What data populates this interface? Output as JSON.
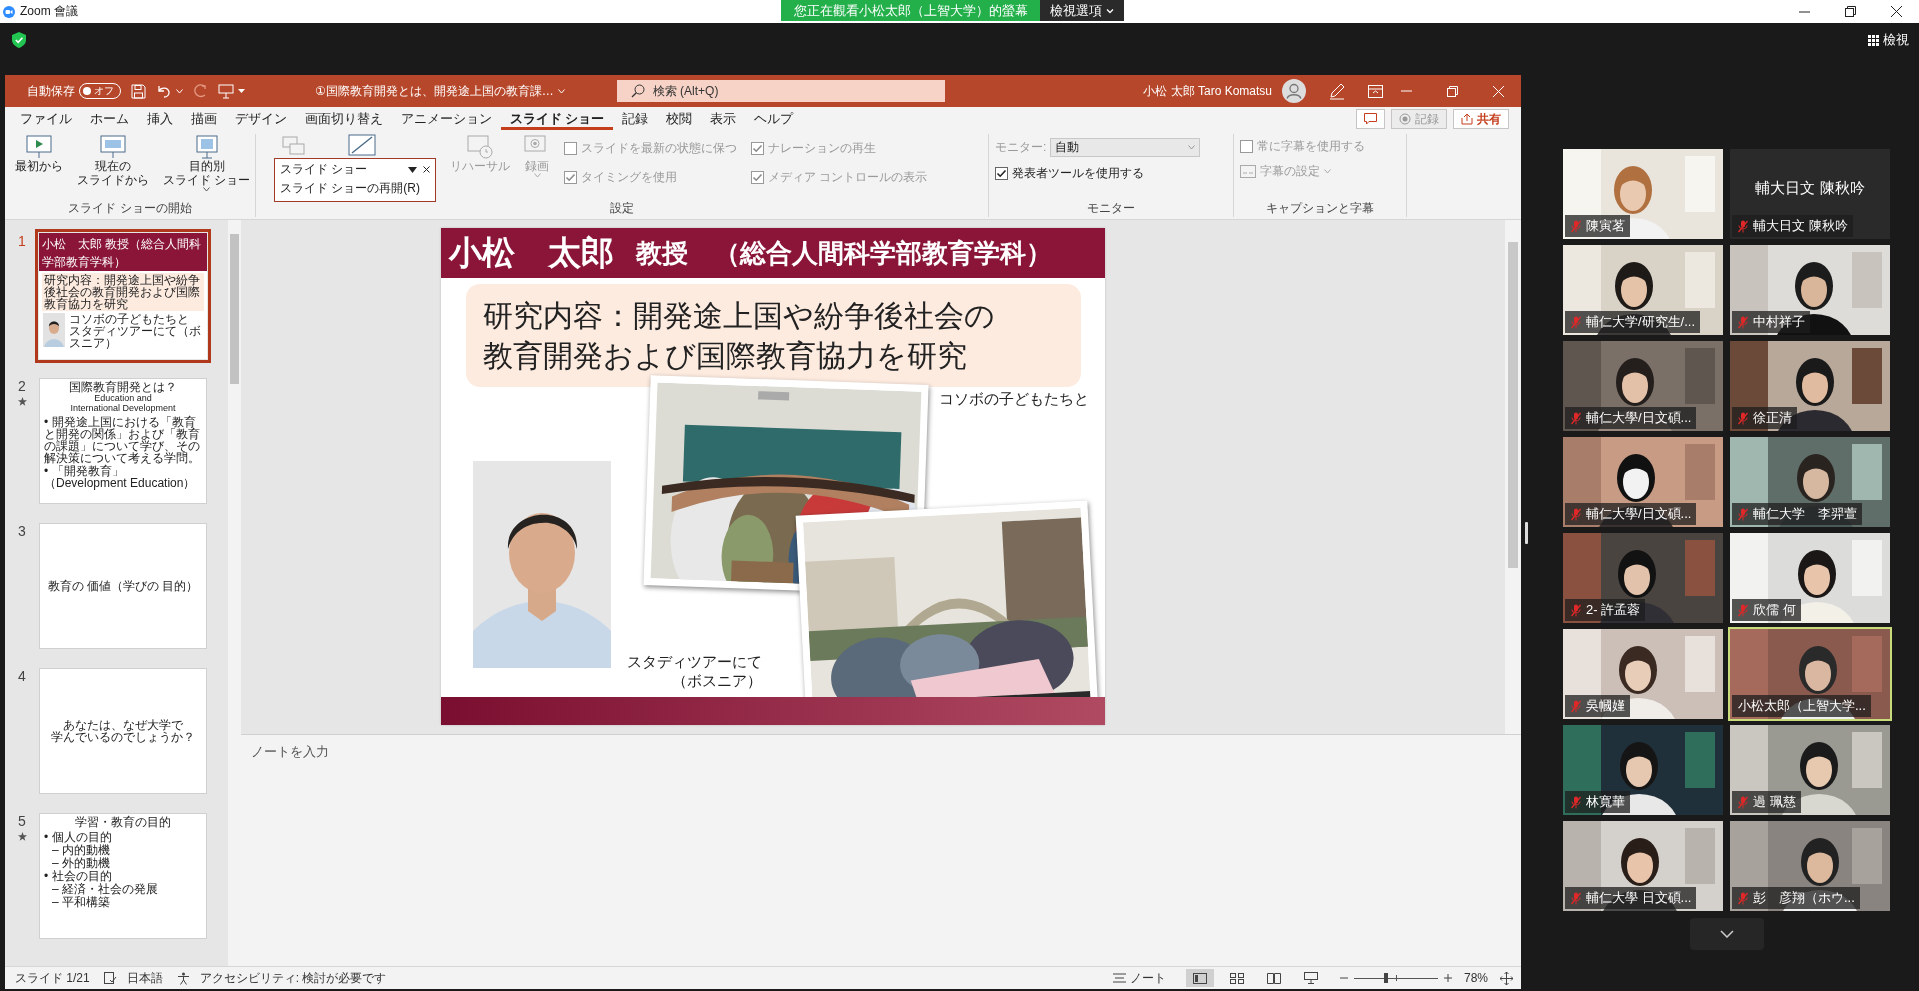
{
  "zoom_window": {
    "title": "Zoom 會議",
    "share_banner": "您正在觀看小松太郎（上智大学）的螢幕",
    "view_options": "檢視選項",
    "view_button": "檢視"
  },
  "powerpoint": {
    "autosave": {
      "label": "自動保存",
      "state": "オフ",
      "on": false
    },
    "document_title": "①国際教育開発とは、開発途上国の教育課…",
    "search": {
      "placeholder": "検索 (Alt+Q)"
    },
    "user_name": "小松 太郎 Taro Komatsu",
    "tabs": [
      {
        "label": "ファイル",
        "selected": false
      },
      {
        "label": "ホーム",
        "selected": false
      },
      {
        "label": "挿入",
        "selected": false
      },
      {
        "label": "描画",
        "selected": false
      },
      {
        "label": "デザイン",
        "selected": false
      },
      {
        "label": "画面切り替え",
        "selected": false
      },
      {
        "label": "アニメーション",
        "selected": false
      },
      {
        "label": "スライド ショー",
        "selected": true
      },
      {
        "label": "記録",
        "selected": false
      },
      {
        "label": "校閲",
        "selected": false
      },
      {
        "label": "表示",
        "selected": false
      },
      {
        "label": "ヘルプ",
        "selected": false
      }
    ],
    "actions": [
      {
        "kind": "comment",
        "disabled": false
      },
      {
        "kind": "record",
        "label": "記録",
        "disabled": true
      },
      {
        "kind": "share",
        "label": "共有",
        "disabled": false
      }
    ],
    "start_group": {
      "label": "スライド ショーの開始",
      "buttons": [
        {
          "lines": [
            "最初から"
          ],
          "disabled": false
        },
        {
          "lines": [
            "現在の",
            "スライドから"
          ],
          "disabled": false
        },
        {
          "lines": [
            "目的別",
            "スライド ショー"
          ],
          "disabled": false,
          "dropdown": true
        }
      ]
    },
    "setup_group": {
      "label": "設定",
      "popup": {
        "title": "スライド ショー",
        "items": [
          "スライド ショーの再開(R)"
        ]
      },
      "buttons": [
        {
          "lines": [
            "リハーサル"
          ],
          "disabled": true
        },
        {
          "lines": [
            "録画"
          ],
          "disabled": true,
          "dropdown": true
        }
      ],
      "checkboxes": [
        {
          "label": "スライドを最新の状態に保つ",
          "checked": false,
          "disabled": true
        },
        {
          "label": "ナレーションの再生",
          "checked": true,
          "disabled": true
        },
        {
          "label": "タイミングを使用",
          "checked": true,
          "disabled": true
        },
        {
          "label": "メディア コントロールの表示",
          "checked": true,
          "disabled": true
        }
      ]
    },
    "monitor_group": {
      "label": "モニター",
      "monitor_label": "モニター:",
      "monitor_value": "自動",
      "monitor_disabled": true,
      "checkboxes": [
        {
          "label": "発表者ツールを使用する",
          "checked": true,
          "disabled": false
        }
      ]
    },
    "captions_group": {
      "label": "キャプションと字幕",
      "checkboxes": [
        {
          "label": "常に字幕を使用する",
          "checked": false,
          "disabled": true
        }
      ],
      "buttons": [
        {
          "lines": [
            "字幕の設定"
          ],
          "disabled": true,
          "dropdown": true
        }
      ]
    },
    "thumbnails": [
      {
        "number": "1",
        "selected": true,
        "kind": "profile",
        "name": "小松　太郎",
        "role": "教授（総合人間科学部教育学科）",
        "text": "研究内容：開発途上国や紛争後社会の教育開発および国際教育協力を研究",
        "captions": [
          "コソボの子どもたちと",
          "スタディツアーにて（ボスニア）"
        ]
      },
      {
        "number": "2",
        "selected": false,
        "animated": true,
        "kind": "bullets",
        "title": "国際教育開発とは？",
        "subtitle_lines": [
          "Education and",
          "International Development"
        ],
        "bullets": [
          {
            "text": "• 開発途上国における「教育と開発の関係」および「教育の課題」について学び、その解決策について考える学問。"
          },
          {
            "text": "• 「開発教育」（Development Education）"
          }
        ]
      },
      {
        "number": "3",
        "selected": false,
        "kind": "title",
        "lines": [
          "教育の 価値（学びの 目的）"
        ]
      },
      {
        "number": "4",
        "selected": false,
        "kind": "title",
        "lines": [
          "あなたは、なぜ大学で",
          "学んでいるのでしょうか？"
        ]
      },
      {
        "number": "5",
        "selected": false,
        "animated": true,
        "kind": "bullets",
        "title": "学習・教育の目的",
        "bullets": [
          {
            "text": "• 個人の目的",
            "sub": [
              "– 内的動機",
              "– 外的動機"
            ]
          },
          {
            "text": "• 社会の目的",
            "sub": [
              "– 経済・社会の発展",
              "– 平和構築"
            ]
          }
        ]
      }
    ],
    "slide": {
      "name": "小松　太郎",
      "role": "教授　（総合人間科学部教育学科）",
      "research_lines": [
        "研究内容：開発途上国や紛争後社会の",
        "教育開発および国際教育協力を研究"
      ],
      "caption_kosovo": "コソボの子どもたちと",
      "caption_tour_lines": [
        "スタディツアーにて",
        "（ボスニア）"
      ]
    },
    "notes": {
      "placeholder": "ノートを入力"
    },
    "status_bar": {
      "slide": "スライド 1/21",
      "language": "日本語",
      "accessibility": "アクセシビリティ: 検討が必要です",
      "notes_button": "ノート",
      "views": [
        {
          "selected": true
        },
        {
          "selected": false
        },
        {
          "selected": false
        },
        {
          "selected": false
        }
      ],
      "zoom": {
        "level": 0.38,
        "percent": "78%"
      }
    }
  },
  "participants": [
    {
      "name": "陳寅茗",
      "muted": true,
      "video": true,
      "active": false
    },
    {
      "name": "輔大日文 陳秋吟",
      "center_name": "輔大日文 陳秋吟",
      "muted": true,
      "video": false,
      "active": false
    },
    {
      "name": "輔仁大学/研究生/...",
      "muted": true,
      "video": true,
      "active": false
    },
    {
      "name": "中村祥子",
      "muted": true,
      "video": true,
      "active": false
    },
    {
      "name": "輔仁大學/日文碩...",
      "muted": true,
      "video": true,
      "active": false
    },
    {
      "name": "徐正清",
      "muted": true,
      "video": true,
      "active": false
    },
    {
      "name": "輔仁大學/日文碩...",
      "muted": true,
      "video": true,
      "active": false
    },
    {
      "name": "輔仁大学　李羿萱",
      "muted": true,
      "video": true,
      "active": false
    },
    {
      "name": "2- 許孟蓉",
      "muted": true,
      "video": true,
      "active": false
    },
    {
      "name": "欣儒 何",
      "muted": true,
      "video": true,
      "active": false
    },
    {
      "name": "吳幗嫤",
      "muted": true,
      "video": true,
      "active": false
    },
    {
      "name": "小松太郎（上智大学...",
      "muted": false,
      "video": true,
      "active": true
    },
    {
      "name": "林寬華",
      "muted": true,
      "video": true,
      "active": false
    },
    {
      "name": "過 珮慈",
      "muted": true,
      "video": true,
      "active": false
    },
    {
      "name": "輔仁大學 日文碩...",
      "muted": true,
      "video": true,
      "active": false
    },
    {
      "name": "彭　彦翔（ホウ...",
      "muted": true,
      "video": true,
      "active": false
    }
  ]
}
